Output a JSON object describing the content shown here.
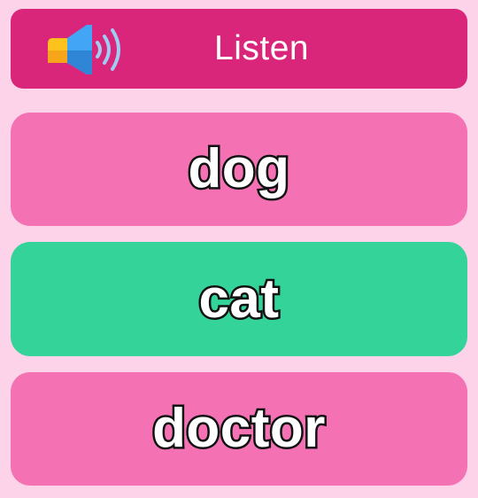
{
  "listen": {
    "label": "Listen",
    "icon": "speaker-icon",
    "color": "#d9267a"
  },
  "choices": [
    {
      "label": "dog",
      "color": "#f472b4"
    },
    {
      "label": "cat",
      "color": "#34d399"
    },
    {
      "label": "doctor",
      "color": "#f472b4"
    }
  ],
  "colors": {
    "background": "#fcd3e8",
    "choice_default": "#f472b4",
    "choice_highlight": "#34d399"
  }
}
